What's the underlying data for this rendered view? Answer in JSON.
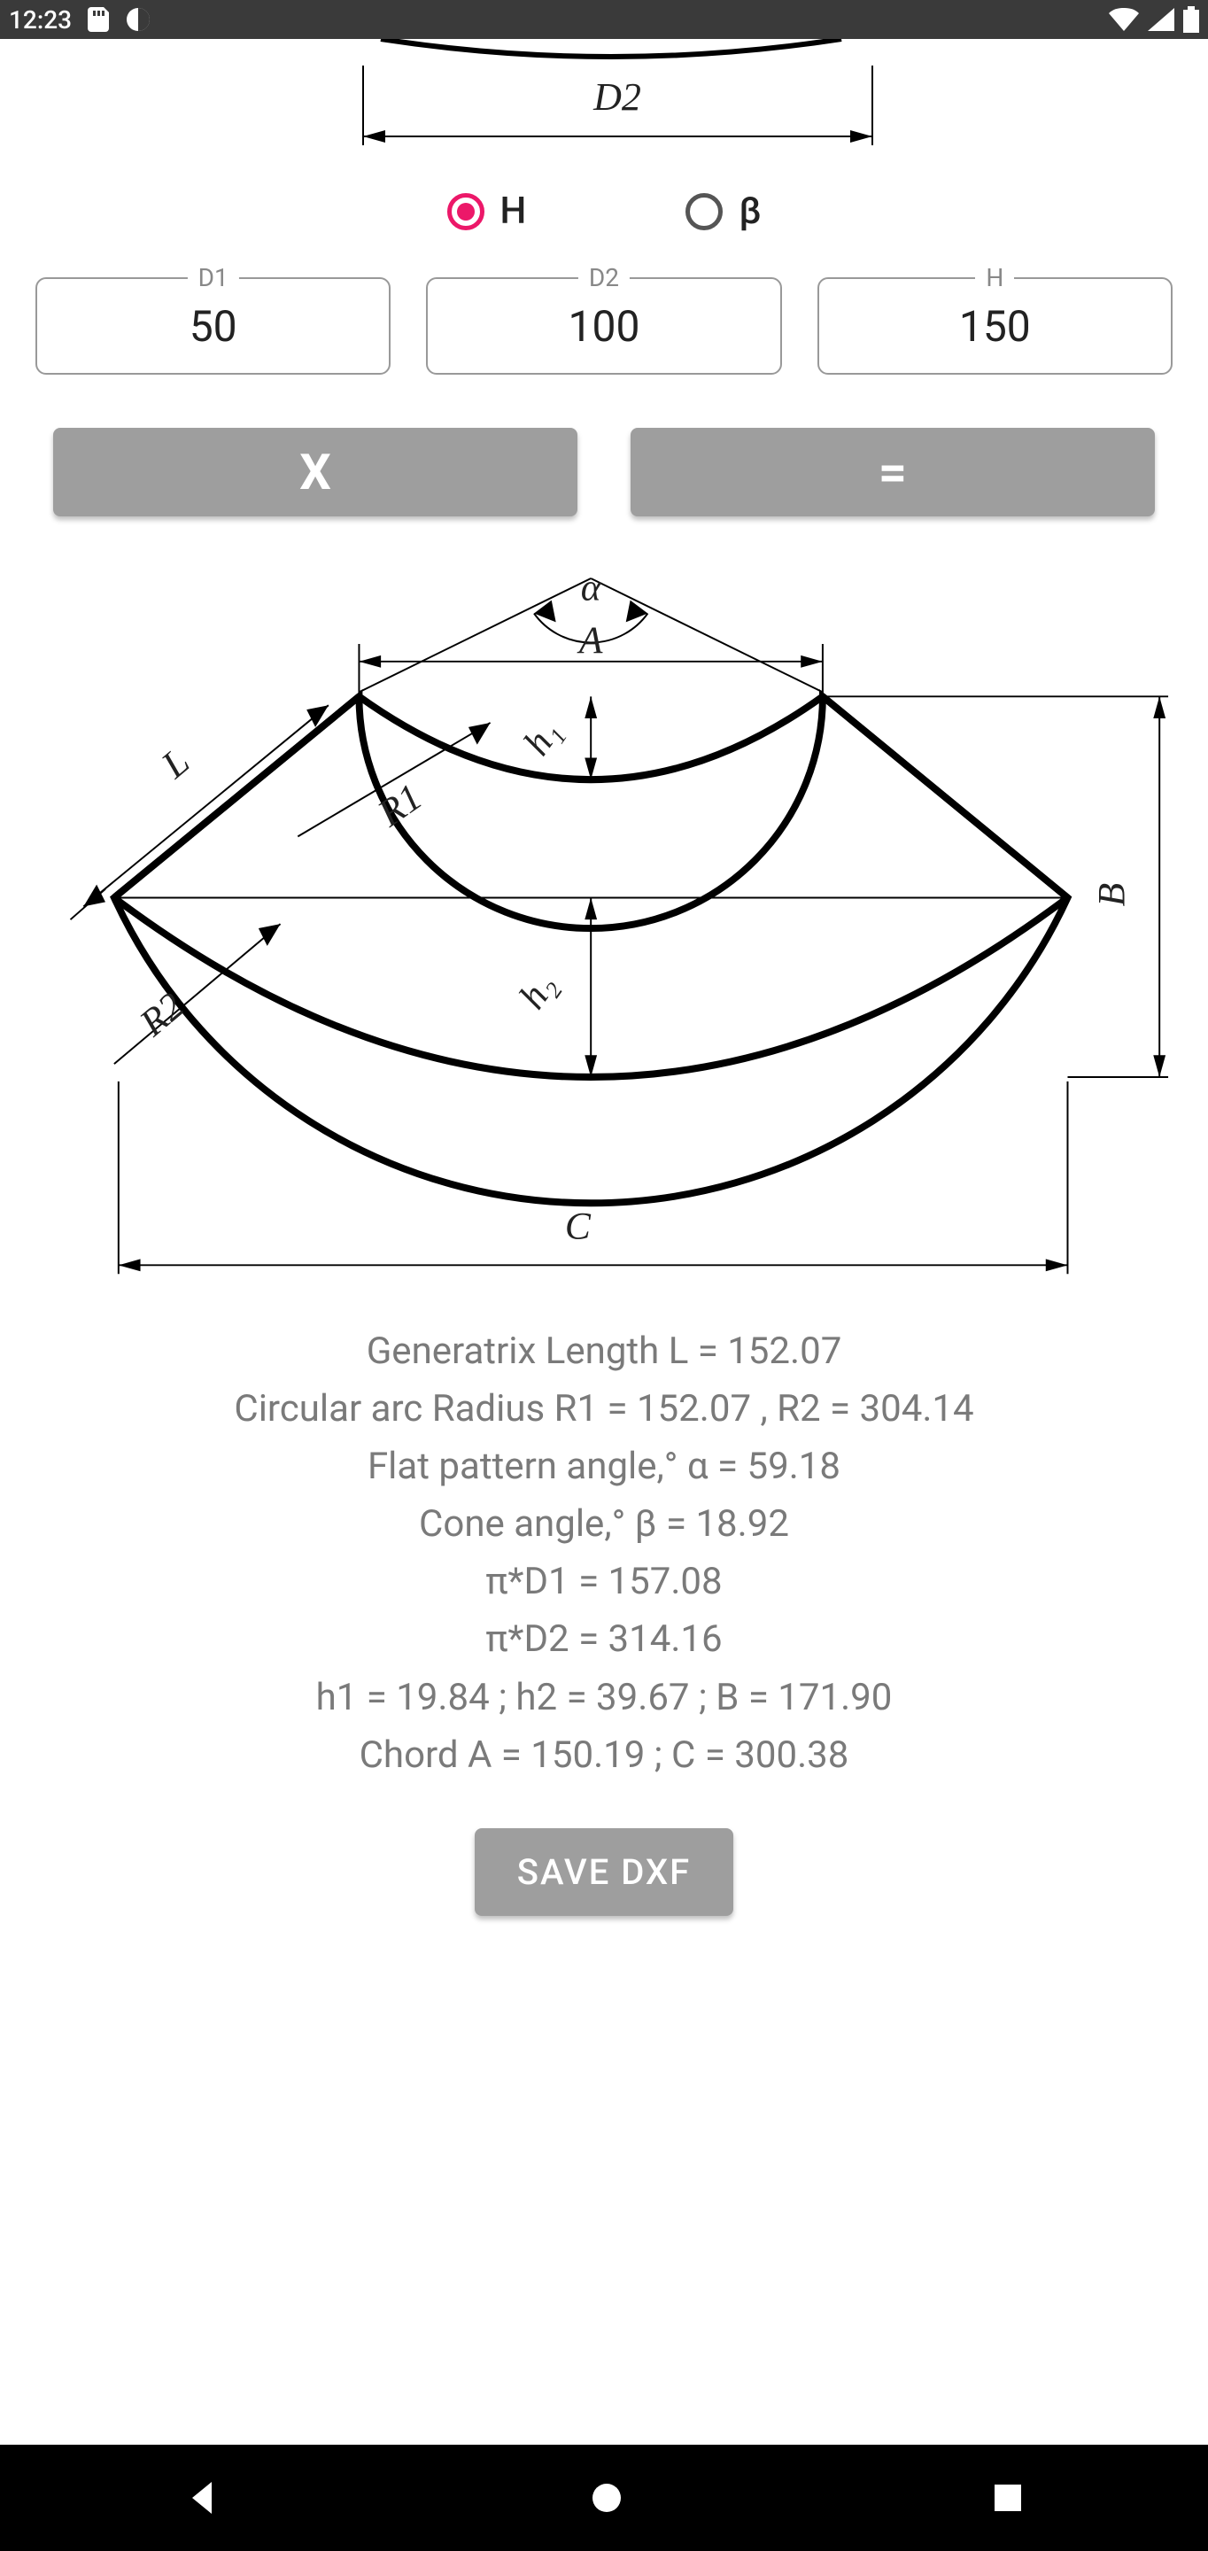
{
  "status": {
    "time": "12:23"
  },
  "radios": {
    "h": "H",
    "beta": "β",
    "selected": "H"
  },
  "inputs": {
    "d1": {
      "label": "D1",
      "value": "50"
    },
    "d2": {
      "label": "D2",
      "value": "100"
    },
    "h": {
      "label": "H",
      "value": "150"
    }
  },
  "buttons": {
    "clear": "X",
    "calc": "="
  },
  "diagram_top": {
    "d2": "D2"
  },
  "diagram_main": {
    "alpha": "α",
    "A": "A",
    "L": "L",
    "h1": "h₁",
    "R1": "R1",
    "h2": "h₂",
    "R2": "R2",
    "C": "C",
    "B": "B"
  },
  "results": {
    "l": "Generatrix Length L = 152.07",
    "r": "Circular arc Radius R1 = 152.07 , R2 = 304.14",
    "a": "Flat pattern angle,° α = 59.18",
    "b": "Cone angle,° β = 18.92",
    "pd1": "π*D1 = 157.08",
    "pd2": "π*D2 = 314.16",
    "h": "h1 = 19.84 ;  h2 = 39.67 ;  B = 171.90",
    "c": "Chord A = 150.19 ;  C = 300.38"
  },
  "save": {
    "label": "SAVE DXF"
  },
  "computed": {
    "L": 152.07,
    "R1": 152.07,
    "R2": 304.14,
    "alpha_deg": 59.18,
    "beta_deg": 18.92,
    "piD1": 157.08,
    "piD2": 314.16,
    "h1": 19.84,
    "h2": 39.67,
    "B": 171.9,
    "A": 150.19,
    "C": 300.38
  }
}
